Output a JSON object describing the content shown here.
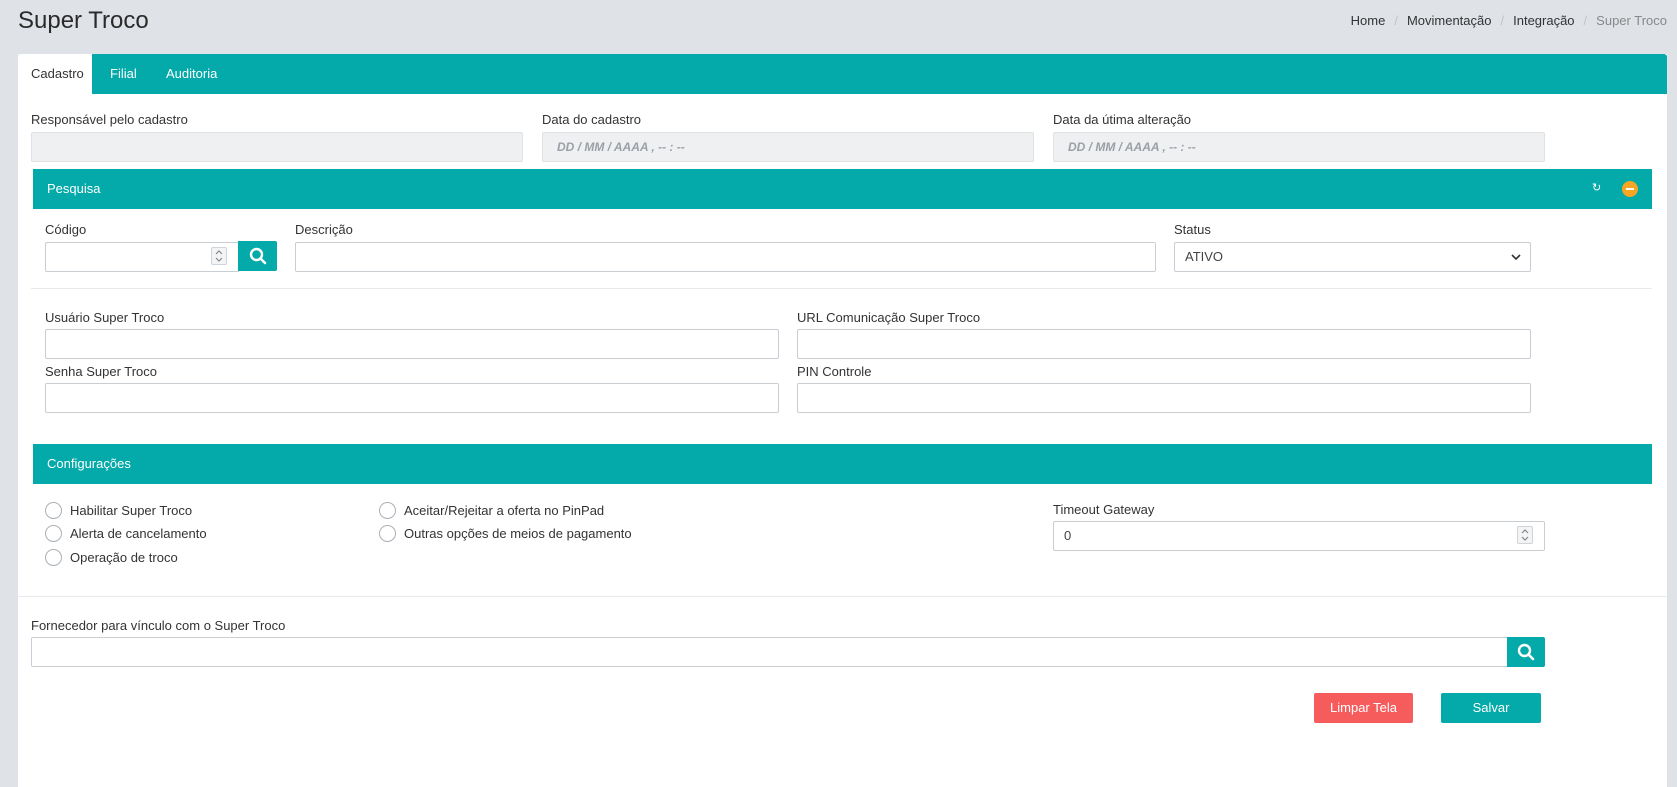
{
  "header": {
    "title": "Super Troco",
    "breadcrumb": [
      "Home",
      "Movimentação",
      "Integração",
      "Super Troco"
    ]
  },
  "tabs": [
    {
      "label": "Cadastro",
      "active": true
    },
    {
      "label": "Filial",
      "active": false
    },
    {
      "label": "Auditoria",
      "active": false
    }
  ],
  "registration": {
    "responsible_label": "Responsável pelo cadastro",
    "responsible_value": "",
    "created_label": "Data do cadastro",
    "created_placeholder": "DD / MM / AAAA ,  -- : --",
    "updated_label": "Data da útima alteração",
    "updated_placeholder": "DD / MM / AAAA ,  -- : --"
  },
  "search_section": {
    "title": "Pesquisa",
    "code_label": "Código",
    "code_value": "",
    "description_label": "Descrição",
    "description_value": "",
    "status_label": "Status",
    "status_value": "ATIVO",
    "user_label": "Usuário Super Troco",
    "user_value": "",
    "url_label": "URL Comunicação Super Troco",
    "url_value": "",
    "password_label": "Senha Super Troco",
    "password_value": "",
    "pin_label": "PIN Controle",
    "pin_value": ""
  },
  "config_section": {
    "title": "Configurações",
    "options_left": [
      "Habilitar Super Troco",
      "Alerta de cancelamento",
      "Operação de troco"
    ],
    "options_right": [
      "Aceitar/Rejeitar a oferta no PinPad",
      "Outras opções de meios de pagamento"
    ],
    "timeout_label": "Timeout Gateway",
    "timeout_value": "0"
  },
  "supplier": {
    "label": "Fornecedor para vínculo com o Super Troco",
    "value": ""
  },
  "actions": {
    "clear_label": "Limpar Tela",
    "save_label": "Salvar"
  },
  "colors": {
    "primary": "#03aaa9",
    "danger": "#f65c5c",
    "warning": "#f6a623",
    "background": "#dfe3e8"
  }
}
